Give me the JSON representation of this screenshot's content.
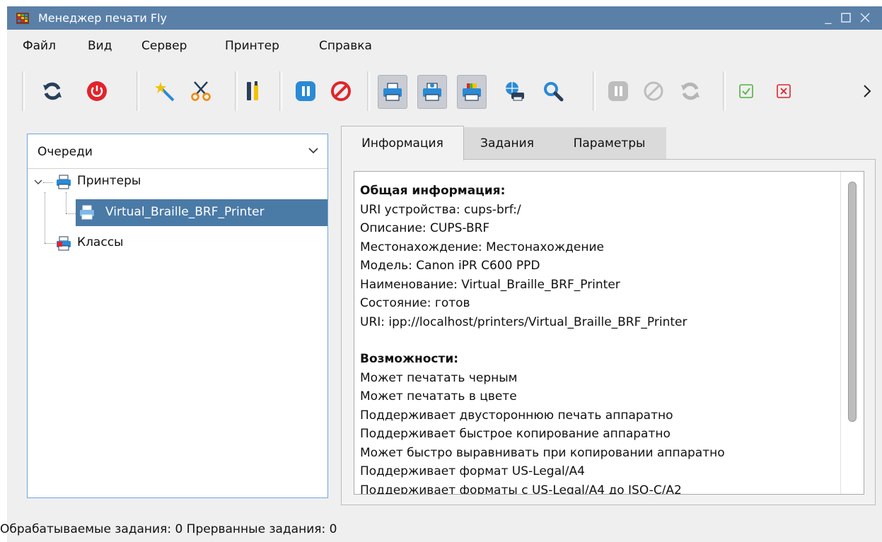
{
  "window": {
    "title": "Менеджер печати Fly",
    "controls": [
      "minimize-icon",
      "maximize-icon",
      "close-icon"
    ]
  },
  "menu": {
    "items": [
      "Файл",
      "Вид",
      "Сервер",
      "Принтер",
      "Справка"
    ]
  },
  "toolbar": {
    "buttons": [
      "refresh-icon",
      "power-icon",
      "wizard-icon",
      "cut-icon",
      "tools-icon",
      "pause-icon",
      "stop-icon",
      "printer-icon",
      "printer-add-icon",
      "printer-color-icon",
      "network-printer-icon",
      "search-icon",
      "pause-disabled-icon",
      "cancel-disabled-icon",
      "refresh-disabled-icon",
      "accept-icon",
      "reject-icon",
      "more-chevron-icon"
    ],
    "colors": {
      "blue": "#2a8ad6",
      "red": "#e0242c",
      "yellow": "#f2c200",
      "green": "#52b043",
      "gray": "#bdbdbd"
    }
  },
  "left_panel": {
    "combo_label": "Очереди",
    "tree": {
      "printers_label": "Принтеры",
      "printer_item": "Virtual_Braille_BRF_Printer",
      "classes_label": "Классы"
    }
  },
  "tabs": [
    "Информация",
    "Задания",
    "Параметры"
  ],
  "info": {
    "general_header": "Общая информация:",
    "general_lines": [
      "URI устройства: cups-brf:/",
      "Описание: CUPS-BRF",
      "Местонахождение: Местонахождение",
      "Модель: Canon iPR C600 PPD",
      "Наименование: Virtual_Braille_BRF_Printer",
      "Состояние: готов",
      "URI: ipp://localhost/printers/Virtual_Braille_BRF_Printer"
    ],
    "capabilities_header": "Возможности:",
    "capability_lines": [
      "Может печатать черным",
      "Может печатать в цвете",
      "Поддерживает двустороннюю печать аппаратно",
      "Поддерживает быстрое копирование аппаратно",
      "Может быстро выравнивать при копировании аппаратно",
      "Поддерживает формат US-Legal/A4",
      "Поддерживает форматы с US-Legal/A4 до ISO-C/A2"
    ]
  },
  "status": {
    "text": "Обрабатываемые задания: 0  Прерванные задания: 0"
  }
}
